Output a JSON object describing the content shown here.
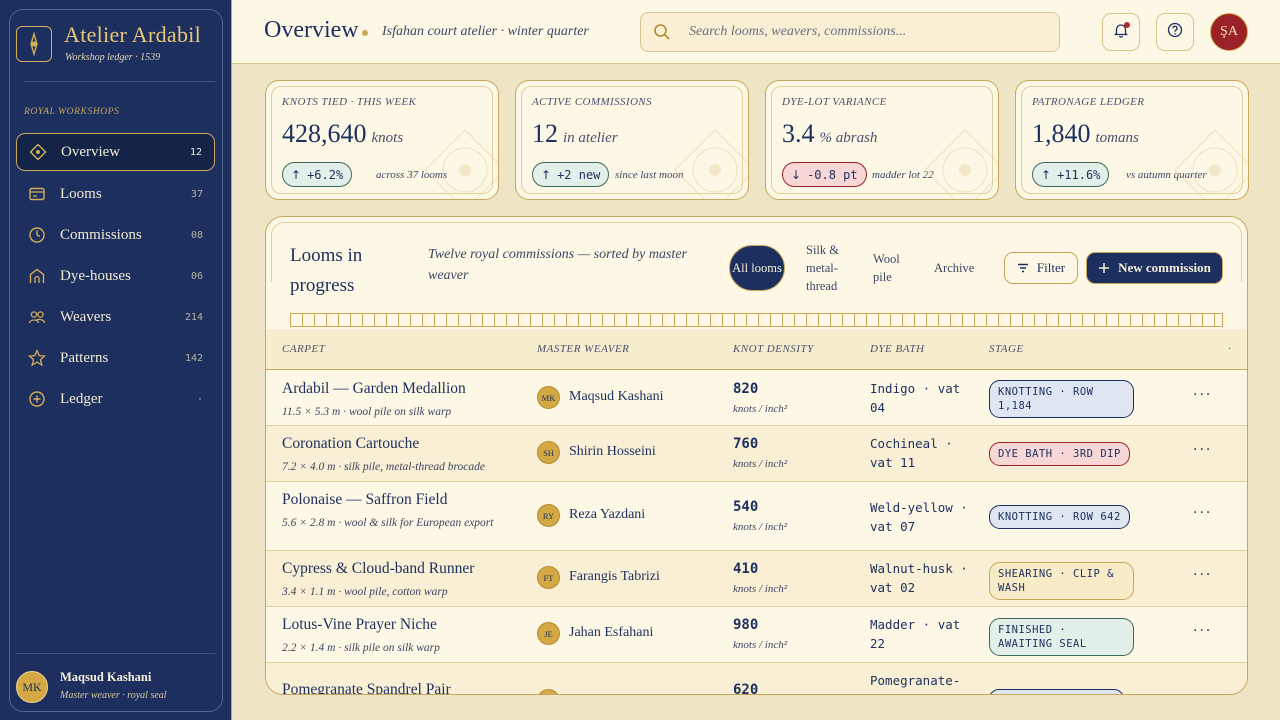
{
  "brand": {
    "title": "Atelier Ardabil",
    "subtitle": "Workshop ledger · 1539"
  },
  "sidebar": {
    "section_label": "ROYAL WORKSHOPS",
    "items": [
      {
        "label": "Overview",
        "count": "12",
        "icon": "diamond-icon",
        "active": true
      },
      {
        "label": "Looms",
        "count": "37",
        "icon": "loom-icon"
      },
      {
        "label": "Commissions",
        "count": "08",
        "icon": "clock-icon"
      },
      {
        "label": "Dye-houses",
        "count": "06",
        "icon": "house-icon"
      },
      {
        "label": "Weavers",
        "count": "214",
        "icon": "people-icon"
      },
      {
        "label": "Patterns",
        "count": "142",
        "icon": "star-icon"
      },
      {
        "label": "Ledger",
        "count": "·",
        "icon": "plus-circle-icon"
      }
    ],
    "user": {
      "initials": "MK",
      "name": "Maqsud Kashani",
      "role": "Master weaver · royal seal"
    }
  },
  "header": {
    "title": "Overview",
    "subtitle": "Isfahan court atelier · winter quarter",
    "search_placeholder": "Search looms, weavers, commissions...",
    "user_initials": "ŞA"
  },
  "stats": [
    {
      "label": "KNOTS TIED · THIS WEEK",
      "value": "428,640",
      "unit": "knots",
      "delta": "+6.2%",
      "direction": "up",
      "note": "across 37 looms"
    },
    {
      "label": "ACTIVE COMMISSIONS",
      "value": "12",
      "unit": "in atelier",
      "delta": "+2 new",
      "direction": "up",
      "note": "since last moon"
    },
    {
      "label": "DYE-LOT VARIANCE",
      "value": "3.4",
      "unit": "% abrash",
      "delta": "-0.8 pt",
      "direction": "down",
      "note": "madder lot 22"
    },
    {
      "label": "PATRONAGE LEDGER",
      "value": "1,840",
      "unit": "tomans",
      "delta": "+11.6%",
      "direction": "up",
      "note": "vs autumn quarter"
    }
  ],
  "panel": {
    "title": "Looms in progress",
    "description": "Twelve royal commissions — sorted by master weaver",
    "segments": [
      "All looms",
      "Silk & metal-thread",
      "Wool pile",
      "Archive"
    ],
    "filter_label": "Filter",
    "new_label": "New commission",
    "columns": [
      "CARPET",
      "MASTER WEAVER",
      "KNOT DENSITY",
      "DYE BATH",
      "STAGE",
      "·"
    ],
    "rows": [
      {
        "name": "Ardabil — Garden Medallion",
        "meta": "11.5 × 5.3 m · wool pile on silk warp",
        "initials": "MK",
        "weaver": "Maqsud Kashani",
        "density": "820",
        "unit": "knots / inch²",
        "dye": "Indigo · vat 04",
        "stage": "KNOTTING · ROW 1,184",
        "stage_kind": "knot"
      },
      {
        "name": "Coronation Cartouche",
        "meta": "7.2 × 4.0 m · silk pile, metal-thread brocade",
        "initials": "SH",
        "weaver": "Shirin Hosseini",
        "density": "760",
        "unit": "knots / inch²",
        "dye": "Cochineal · vat 11",
        "stage": "DYE BATH · 3RD DIP",
        "stage_kind": "dye"
      },
      {
        "name": "Polonaise — Saffron Field",
        "meta": "5.6 × 2.8 m · wool & silk for European export",
        "initials": "RY",
        "weaver": "Reza Yazdani",
        "density": "540",
        "unit": "knots / inch²",
        "dye": "Weld-yellow · vat 07",
        "stage": "KNOTTING · ROW 642",
        "stage_kind": "knot"
      },
      {
        "name": "Cypress & Cloud-band Runner",
        "meta": "3.4 × 1.1 m · wool pile, cotton warp",
        "initials": "FT",
        "weaver": "Farangis Tabrizi",
        "density": "410",
        "unit": "knots / inch²",
        "dye": "Walnut-husk · vat 02",
        "stage": "SHEARING · CLIP & WASH",
        "stage_kind": "shear"
      },
      {
        "name": "Lotus-Vine Prayer Niche",
        "meta": "2.2 × 1.4 m · silk pile on silk warp",
        "initials": "JE",
        "weaver": "Jahan Esfahani",
        "density": "980",
        "unit": "knots / inch²",
        "dye": "Madder · vat 22",
        "stage": "FINISHED · AWAITING SEAL",
        "stage_kind": "done"
      },
      {
        "name": "Pomegranate Spandrel Pair",
        "meta": "",
        "initials": "",
        "weaver": "",
        "density": "620",
        "unit": "",
        "dye": "Pomegranate-",
        "stage": "",
        "stage_kind": "knot"
      }
    ]
  },
  "colors": {
    "navy": "#1c2f5e",
    "gold": "#c8a75a",
    "parchment": "#fdf8e6",
    "crimson": "#9a2226",
    "jade": "#3d6a5b"
  }
}
